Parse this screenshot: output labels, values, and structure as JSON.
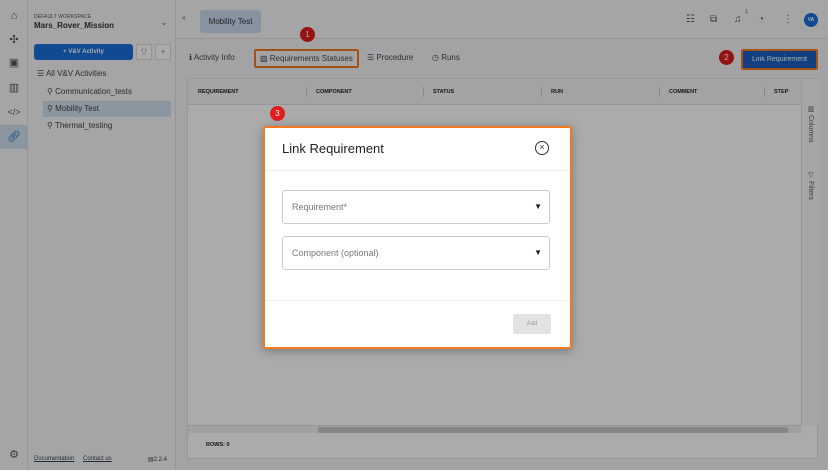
{
  "rail": {
    "icons": [
      "home-icon",
      "network-icon",
      "clipboard-icon",
      "chart-icon",
      "code-icon",
      "link-icon",
      "settings-icon"
    ]
  },
  "workspace": {
    "label": "DEFAULT WORKSPACE",
    "name": "Mars_Rover_Mission"
  },
  "sidebar": {
    "add_button": "+ V&V Activity",
    "add_small": "+",
    "all_label": "All V&V Activities",
    "items": [
      {
        "label": "Communication_tests"
      },
      {
        "label": "Mobility Test",
        "active": true
      },
      {
        "label": "Thermal_testing"
      }
    ],
    "footer": {
      "documentation": "Documentation",
      "contact": "Contact us",
      "version": "2.2.4"
    }
  },
  "topbar": {
    "open_tab": "Mobility Test",
    "notification_count": "1",
    "avatar": "VA"
  },
  "subtabs": [
    "Activity Info",
    "Requirements Statuses",
    "Procedure",
    "Runs"
  ],
  "link_button": "Link Requirement",
  "annotations": [
    "1",
    "2",
    "3"
  ],
  "grid": {
    "columns": [
      "REQUIREMENT",
      "COMPONENT",
      "STATUS",
      "RUN",
      "COMMENT",
      "STEP"
    ],
    "side": [
      "Columns",
      "Filters"
    ],
    "rows_label": "ROWS: 0"
  },
  "modal": {
    "title": "Link Requirement",
    "requirement_placeholder": "Requirement*",
    "component_placeholder": "Component (optional)",
    "add_button": "Add"
  }
}
